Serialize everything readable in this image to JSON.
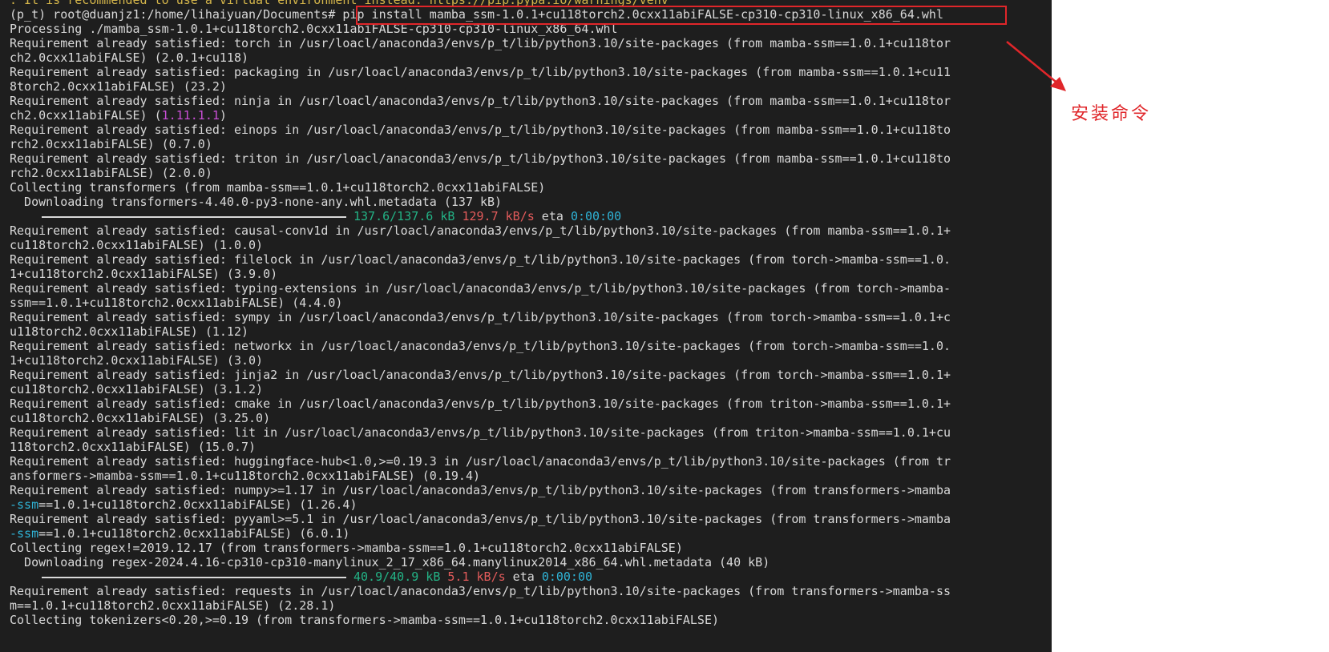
{
  "terminal": {
    "lines": [
      {
        "segments": [
          {
            "text": ". It is recommended to use a virtual environment instead: https://pip.pypa.io/warnings/venv",
            "color": "yellow"
          }
        ]
      },
      {
        "segments": [
          {
            "text": "(p_t) root@duanjz1:/home/lihaiyuan/Documents# "
          },
          {
            "text": "pip install mamba_ssm-1.0.1+cu118torch2.0cxx11abiFALSE-cp310-cp310-linux_x86_64.whl"
          }
        ]
      },
      {
        "segments": [
          {
            "text": "Processing ./mamba_ssm-1.0.1+cu118torch2.0cxx11abiFALSE-cp310-cp310-linux_x86_64.whl"
          }
        ]
      },
      {
        "segments": [
          {
            "text": "Requirement already satisfied: torch in /usr/loacl/anaconda3/envs/p_t/lib/python3.10/site-packages (from mamba-ssm==1.0.1+cu118tor"
          }
        ]
      },
      {
        "segments": [
          {
            "text": "ch2.0cxx11abiFALSE) (2.0.1+cu118)"
          }
        ]
      },
      {
        "segments": [
          {
            "text": "Requirement already satisfied: packaging in /usr/loacl/anaconda3/envs/p_t/lib/python3.10/site-packages (from mamba-ssm==1.0.1+cu11"
          }
        ]
      },
      {
        "segments": [
          {
            "text": "8torch2.0cxx11abiFALSE) (23.2)"
          }
        ]
      },
      {
        "segments": [
          {
            "text": "Requirement already satisfied: ninja in /usr/loacl/anaconda3/envs/p_t/lib/python3.10/site-packages (from mamba-ssm==1.0.1+cu118tor"
          }
        ]
      },
      {
        "segments": [
          {
            "text": "ch2.0cxx11abiFALSE) ("
          },
          {
            "text": "1.11.1.1",
            "color": "magenta"
          },
          {
            "text": ")"
          }
        ]
      },
      {
        "segments": [
          {
            "text": "Requirement already satisfied: einops in /usr/loacl/anaconda3/envs/p_t/lib/python3.10/site-packages (from mamba-ssm==1.0.1+cu118to"
          }
        ]
      },
      {
        "segments": [
          {
            "text": "rch2.0cxx11abiFALSE) (0.7.0)"
          }
        ]
      },
      {
        "segments": [
          {
            "text": "Requirement already satisfied: triton in /usr/loacl/anaconda3/envs/p_t/lib/python3.10/site-packages (from mamba-ssm==1.0.1+cu118to"
          }
        ]
      },
      {
        "segments": [
          {
            "text": "rch2.0cxx11abiFALSE) (2.0.0)"
          }
        ]
      },
      {
        "segments": [
          {
            "text": "Collecting transformers (from mamba-ssm==1.0.1+cu118torch2.0cxx11abiFALSE)"
          }
        ]
      },
      {
        "segments": [
          {
            "text": "  Downloading transformers-4.40.0-py3-none-any.whl.metadata (137 kB)"
          }
        ]
      },
      {
        "progress": 1.0,
        "segments": [
          {
            "text": "137.6/137.6 kB",
            "color": "green"
          },
          {
            "text": " "
          },
          {
            "text": "129.7 kB/s",
            "color": "red"
          },
          {
            "text": " eta "
          },
          {
            "text": "0:00:00",
            "color": "cyan"
          }
        ]
      },
      {
        "segments": [
          {
            "text": "Requirement already satisfied: causal-conv1d in /usr/loacl/anaconda3/envs/p_t/lib/python3.10/site-packages (from mamba-ssm==1.0.1+"
          }
        ]
      },
      {
        "segments": [
          {
            "text": "cu118torch2.0cxx11abiFALSE) (1.0.0)"
          }
        ]
      },
      {
        "segments": [
          {
            "text": "Requirement already satisfied: filelock in /usr/loacl/anaconda3/envs/p_t/lib/python3.10/site-packages (from torch->mamba-ssm==1.0."
          }
        ]
      },
      {
        "segments": [
          {
            "text": "1+cu118torch2.0cxx11abiFALSE) (3.9.0)"
          }
        ]
      },
      {
        "segments": [
          {
            "text": "Requirement already satisfied: typing-extensions in /usr/loacl/anaconda3/envs/p_t/lib/python3.10/site-packages (from torch->mamba-"
          }
        ]
      },
      {
        "segments": [
          {
            "text": "ssm==1.0.1+cu118torch2.0cxx11abiFALSE) (4.4.0)"
          }
        ]
      },
      {
        "segments": [
          {
            "text": "Requirement already satisfied: sympy in /usr/loacl/anaconda3/envs/p_t/lib/python3.10/site-packages (from torch->mamba-ssm==1.0.1+c"
          }
        ]
      },
      {
        "segments": [
          {
            "text": "u118torch2.0cxx11abiFALSE) (1.12)"
          }
        ]
      },
      {
        "segments": [
          {
            "text": "Requirement already satisfied: networkx in /usr/loacl/anaconda3/envs/p_t/lib/python3.10/site-packages (from torch->mamba-ssm==1.0."
          }
        ]
      },
      {
        "segments": [
          {
            "text": "1+cu118torch2.0cxx11abiFALSE) (3.0)"
          }
        ]
      },
      {
        "segments": [
          {
            "text": "Requirement already satisfied: jinja2 in /usr/loacl/anaconda3/envs/p_t/lib/python3.10/site-packages (from torch->mamba-ssm==1.0.1+"
          }
        ]
      },
      {
        "segments": [
          {
            "text": "cu118torch2.0cxx11abiFALSE) (3.1.2)"
          }
        ]
      },
      {
        "segments": [
          {
            "text": "Requirement already satisfied: cmake in /usr/loacl/anaconda3/envs/p_t/lib/python3.10/site-packages (from triton->mamba-ssm==1.0.1+"
          }
        ]
      },
      {
        "segments": [
          {
            "text": "cu118torch2.0cxx11abiFALSE) (3.25.0)"
          }
        ]
      },
      {
        "segments": [
          {
            "text": "Requirement already satisfied: lit in /usr/loacl/anaconda3/envs/p_t/lib/python3.10/site-packages (from triton->mamba-ssm==1.0.1+cu"
          }
        ]
      },
      {
        "segments": [
          {
            "text": "118torch2.0cxx11abiFALSE) (15.0.7)"
          }
        ]
      },
      {
        "segments": [
          {
            "text": "Requirement already satisfied: huggingface-hub<1.0,>=0.19.3 in /usr/loacl/anaconda3/envs/p_t/lib/python3.10/site-packages (from tr"
          }
        ]
      },
      {
        "segments": [
          {
            "text": "ansformers->mamba-ssm==1.0.1+cu118torch2.0cxx11abiFALSE) (0.19.4)"
          }
        ]
      },
      {
        "segments": [
          {
            "text": "Requirement already satisfied: numpy>=1.17 in /usr/loacl/anaconda3/envs/p_t/lib/python3.10/site-packages (from transformers->mamba"
          }
        ]
      },
      {
        "segments": [
          {
            "text": "-ssm",
            "color": "cyan"
          },
          {
            "text": "==1.0.1+cu118torch2.0cxx11abiFALSE) (1.26.4)"
          }
        ]
      },
      {
        "segments": [
          {
            "text": "Requirement already satisfied: pyyaml>=5.1 in /usr/loacl/anaconda3/envs/p_t/lib/python3.10/site-packages (from transformers->mamba"
          }
        ]
      },
      {
        "segments": [
          {
            "text": "-ssm",
            "color": "cyan"
          },
          {
            "text": "==1.0.1+cu118torch2.0cxx11abiFALSE) (6.0.1)"
          }
        ]
      },
      {
        "segments": [
          {
            "text": "Collecting regex!=2019.12.17 (from transformers->mamba-ssm==1.0.1+cu118torch2.0cxx11abiFALSE)"
          }
        ]
      },
      {
        "segments": [
          {
            "text": "  Downloading regex-2024.4.16-cp310-cp310-manylinux_2_17_x86_64.manylinux2014_x86_64.whl.metadata (40 kB)"
          }
        ]
      },
      {
        "progress": 1.0,
        "segments": [
          {
            "text": "40.9/40.9 kB",
            "color": "green"
          },
          {
            "text": " "
          },
          {
            "text": "5.1 kB/s",
            "color": "red"
          },
          {
            "text": " eta "
          },
          {
            "text": "0:00:00",
            "color": "cyan"
          }
        ]
      },
      {
        "segments": [
          {
            "text": "Requirement already satisfied: requests in /usr/loacl/anaconda3/envs/p_t/lib/python3.10/site-packages (from transformers->mamba-ss"
          }
        ]
      },
      {
        "segments": [
          {
            "text": "m==1.0.1+cu118torch2.0cxx11abiFALSE) (2.28.1)"
          }
        ]
      },
      {
        "segments": [
          {
            "text": "Collecting tokenizers<0.20,>=0.19 (from transformers->mamba-ssm==1.0.1+cu118torch2.0cxx11abiFALSE)"
          }
        ]
      }
    ]
  },
  "annotation": {
    "label": "安装命令",
    "color": "#e0262a"
  },
  "colors": {
    "background": "#1e1e1e",
    "text": "#d9d9d9",
    "green": "#23b386",
    "red": "#e35b5b",
    "cyan": "#2fb3d6",
    "magenta": "#c94fd6",
    "yellow": "#d4b54a"
  }
}
